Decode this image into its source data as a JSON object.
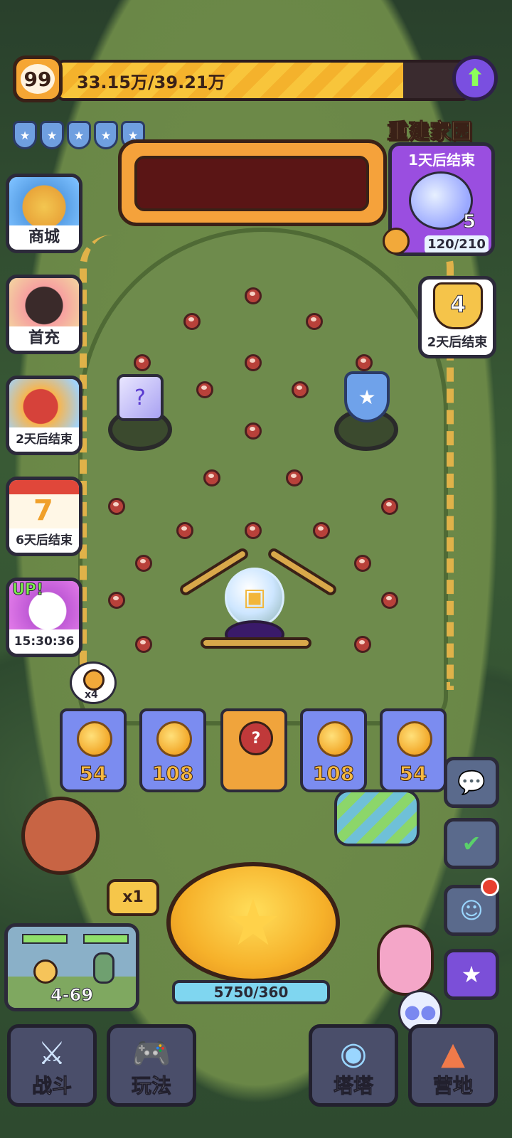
{
  "player": {
    "level": "99",
    "xp_text": "33.15万/39.21万",
    "xp_fraction": 0.845
  },
  "shields": {
    "count": 5
  },
  "left_menu": [
    {
      "label": "商城",
      "icon": "shop-basket-icon"
    },
    {
      "label": "首充",
      "icon": "first-recharge-icon"
    },
    {
      "label": "2天后结束",
      "icon": "bird-event-icon"
    },
    {
      "label": "6天后结束",
      "icon": "calendar-7-icon"
    },
    {
      "label": "15:30:36",
      "badge": "UP!",
      "icon": "up-pet-icon"
    }
  ],
  "rebuild_event": {
    "title": "重建家园",
    "timer": "1天后结束",
    "count": "5",
    "progress": "120/210"
  },
  "trophy_event": {
    "count": "4",
    "timer": "2天后结束"
  },
  "key_badge": {
    "count": "x4"
  },
  "slots": [
    {
      "value": "54"
    },
    {
      "value": "108"
    },
    {
      "value": "",
      "special": true
    },
    {
      "value": "108"
    },
    {
      "value": "54"
    }
  ],
  "launcher": {
    "multiplier": "x1",
    "progress": "5750/360"
  },
  "stage": {
    "label": "4-69"
  },
  "bottom_nav": [
    {
      "label": "战斗",
      "icon": "crossed-swords-icon"
    },
    {
      "label": "玩法",
      "icon": "gamepad-icon"
    },
    {
      "label": "塔塔",
      "icon": "cat-robot-icon"
    },
    {
      "label": "营地",
      "icon": "tent-icon"
    }
  ],
  "colors": {
    "xp_fill": "#f8c53b",
    "slot_blue": "#7b8cf0",
    "slot_special": "#f0a43c",
    "accent_purple": "#9a4ee0"
  }
}
